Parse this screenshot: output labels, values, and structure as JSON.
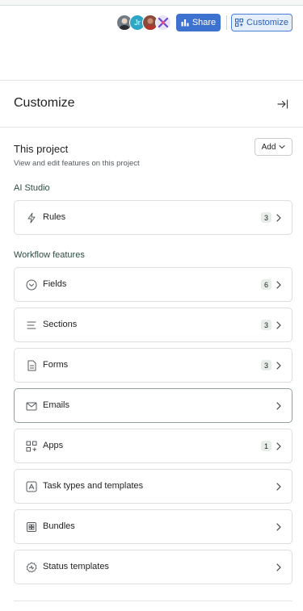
{
  "toolbar": {
    "avatars": [
      {
        "name": "avatar-photo-1",
        "initials": ""
      },
      {
        "name": "avatar-jr",
        "initials": "Jr"
      },
      {
        "name": "avatar-photo-2",
        "initials": ""
      },
      {
        "name": "avatar-icon-4",
        "initials": ""
      }
    ],
    "share_label": "Share",
    "customize_label": "Customize",
    "share_color": "#3d72d0",
    "customize_color": "#e5eefb"
  },
  "panel": {
    "title": "Customize"
  },
  "project": {
    "title": "This project",
    "subtitle": "View and edit features on this project",
    "add_label": "Add"
  },
  "groups": {
    "ai_studio": "AI Studio",
    "workflow": "Workflow features"
  },
  "ai_items": [
    {
      "label": "Rules",
      "count": "3",
      "icon": "lightning-icon"
    }
  ],
  "workflow_items": [
    {
      "label": "Fields",
      "count": "6",
      "icon": "chevron-circle-icon"
    },
    {
      "label": "Sections",
      "count": "3",
      "icon": "lines-icon"
    },
    {
      "label": "Forms",
      "count": "3",
      "icon": "form-icon"
    },
    {
      "label": "Emails",
      "count": "",
      "icon": "envelope-icon"
    },
    {
      "label": "Apps",
      "count": "1",
      "icon": "apps-icon"
    },
    {
      "label": "Task types and templates",
      "count": "",
      "icon": "template-icon"
    },
    {
      "label": "Bundles",
      "count": "",
      "icon": "bundle-icon"
    },
    {
      "label": "Status templates",
      "count": "",
      "icon": "status-icon"
    }
  ]
}
